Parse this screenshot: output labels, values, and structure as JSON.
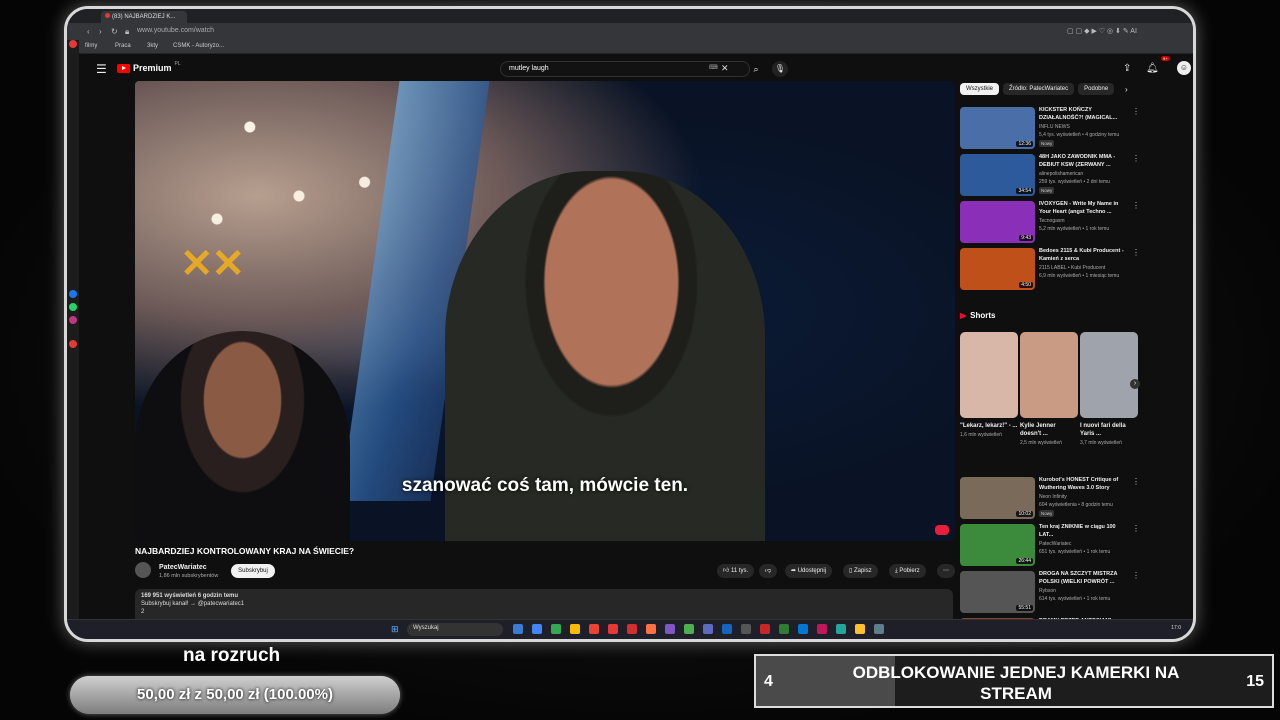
{
  "browser": {
    "tab_title": "(83) NAJBARDZIEJ K...",
    "url": "www.youtube.com/watch",
    "bookmarks": [
      "filmy",
      "Praca",
      "3kty",
      "CSMK - Autoryzo..."
    ]
  },
  "youtube": {
    "logo_text": "Premium",
    "logo_region": "PL",
    "search_value": "mutley laugh",
    "notification_count": "9+"
  },
  "video": {
    "subtitle": "szanować coś tam, mówcie ten.",
    "title": "NAJBARDZIEJ KONTROLOWANY KRAJ NA ŚWIECIE?",
    "channel": "PatecWariatec",
    "subscribers": "1,86 mln subskrybentów",
    "subscribe_label": "Subskrybuj",
    "likes": "11 tys.",
    "share_label": "Udostępnij",
    "save_label": "Zapisz",
    "download_label": "Pobierz",
    "description_line1": "169 951 wyświetleń  6 godzin temu",
    "description_line2": "Subskrybuj kanał! → @patecwariatec1",
    "description_line3": "2"
  },
  "sidebar": {
    "chips": [
      "Wszystkie",
      "Źródło: PatecWariatec",
      "Podobne"
    ],
    "recommendations_top": [
      {
        "title": "KICKSTER KOŃCZY DZIAŁALNOŚĆ?! (MAGICAL...",
        "channel": "INFLU NEWS",
        "meta": "5,4 tys. wyświetleń • 4 godziny temu",
        "duration": "12:36",
        "badge": "Nowy",
        "color": "#4a6fa8"
      },
      {
        "title": "48H JAKO ZAWODNIK MMA - DEBIUT KSW (ZERWANY ...",
        "channel": "alinepolishamerican",
        "meta": "259 tys. wyświetleń • 2 dni temu",
        "duration": "34:54",
        "badge": "Nowy",
        "color": "#2d5a9a"
      },
      {
        "title": "IVOXYGEN - Write My Name in Your Heart (angst Techno ...",
        "channel": "Tecnogasm",
        "meta": "5,2 mln wyświetleń • 1 rok temu",
        "duration": "9:43",
        "badge": "",
        "color": "#8a2fb8"
      },
      {
        "title": "Bedoes 2115 & Kubi Producent - Kamień z serca",
        "channel": "2115 LABEL • Kubi Producent",
        "meta": "6,9 mln wyświetleń • 1 miesiąc temu",
        "duration": "4:50",
        "badge": "",
        "color": "#c0501a"
      }
    ],
    "shorts_heading": "Shorts",
    "shorts": [
      {
        "title": "\"Lekarz, lekarz!\" - ...",
        "views": "1,6 mln wyświetleń",
        "color": "#d9b7a8"
      },
      {
        "title": "Kylie Jenner doesn't ...",
        "views": "2,5 mln wyświetleń",
        "color": "#c99a84"
      },
      {
        "title": "I nuovi fari della Yaris ...",
        "views": "3,7 mln wyświetleń",
        "color": "#9fa3ab"
      }
    ],
    "recommendations_bottom": [
      {
        "title": "Kurobot's HONEST Critique of Wuthering Waves 3.0 Story",
        "channel": "Neon Infinity",
        "meta": "604 wyświetlenia • 8 godzin temu",
        "duration": "10:02",
        "badge": "Nowy",
        "color": "#7a6a5a"
      },
      {
        "title": "Ten kraj ZNIKNIE w ciągu 100 LAT...",
        "channel": "PatecWariatec",
        "meta": "651 tys. wyświetleń • 1 rok temu",
        "duration": "26:44",
        "badge": "",
        "color": "#3c8a3c"
      },
      {
        "title": "DROGA NA SZCZYT MISTRZA POLSKI (WIELKI POWRÓT ...",
        "channel": "Rybson",
        "meta": "614 tys. wyświetleń • 1 rok temu",
        "duration": "55:51",
        "badge": "",
        "color": "#555555"
      },
      {
        "title": "DRAMY PRZED ANTOSIAMI",
        "channel": "",
        "meta": "",
        "duration": "",
        "badge": "",
        "color": "#884433"
      }
    ]
  },
  "taskbar": {
    "search_placeholder": "Wyszukaj",
    "clock": "17:0"
  },
  "overlay": {
    "warmup_label": "na rozruch",
    "goal_text": "50,00 zł z 50,00 zł (100.00%)",
    "goal_progress": 1.0,
    "goal2_current": "4",
    "goal2_title": "ODBLOKOWANIE JEDNEJ KAMERKI NA STREAM",
    "goal2_max": "15",
    "goal2_progress": 0.27
  }
}
